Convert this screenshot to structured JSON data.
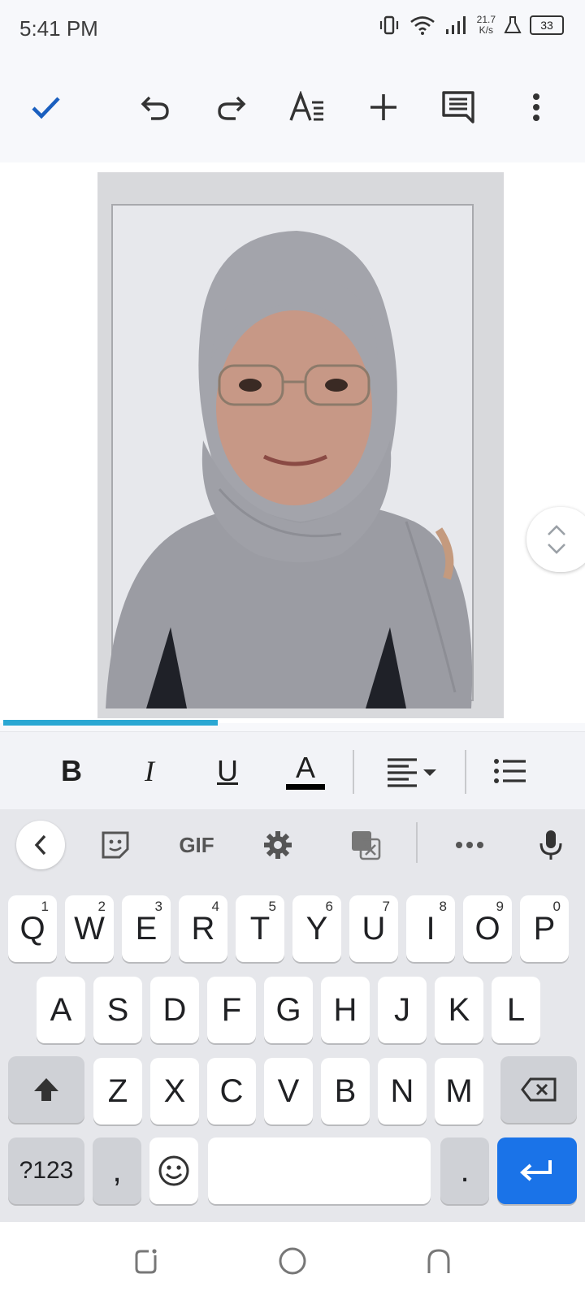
{
  "status": {
    "time": "5:41 PM",
    "net_speed_value": "21.7",
    "net_speed_unit": "K/s",
    "battery": "33"
  },
  "toolbar": {
    "done_icon": "check-icon",
    "undo_icon": "undo-icon",
    "redo_icon": "redo-icon",
    "text_format_icon": "text-format-icon",
    "insert_icon": "plus-icon",
    "comment_icon": "comment-icon",
    "more_icon": "more-vert-icon",
    "accent": "#1a73e8"
  },
  "document": {
    "image": "passport-photo"
  },
  "format_bar": {
    "bold": "B",
    "italic": "I",
    "underline": "U",
    "text_color": "A"
  },
  "keyboard": {
    "toolbar": {
      "gif": "GIF"
    },
    "row1": [
      {
        "label": "Q",
        "hint": "1"
      },
      {
        "label": "W",
        "hint": "2"
      },
      {
        "label": "E",
        "hint": "3"
      },
      {
        "label": "R",
        "hint": "4"
      },
      {
        "label": "T",
        "hint": "5"
      },
      {
        "label": "Y",
        "hint": "6"
      },
      {
        "label": "U",
        "hint": "7"
      },
      {
        "label": "I",
        "hint": "8"
      },
      {
        "label": "O",
        "hint": "9"
      },
      {
        "label": "P",
        "hint": "0"
      }
    ],
    "row2": [
      "A",
      "S",
      "D",
      "F",
      "G",
      "H",
      "J",
      "K",
      "L"
    ],
    "row3": [
      "Z",
      "X",
      "C",
      "V",
      "B",
      "N",
      "M"
    ],
    "row4": {
      "symbols": "?123",
      "comma": ",",
      "period": "."
    },
    "enter_color": "#1a73e8"
  }
}
